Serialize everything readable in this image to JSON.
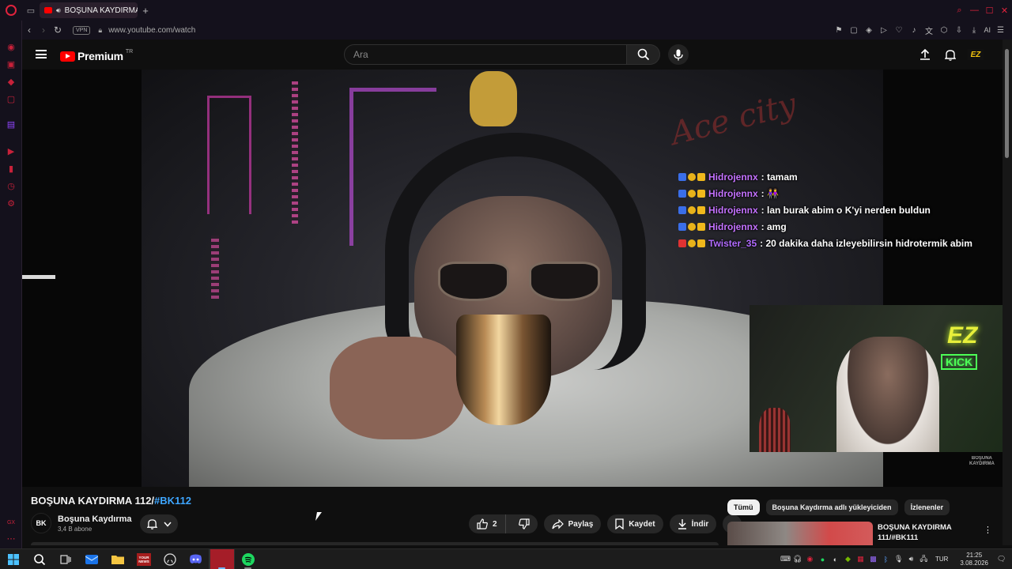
{
  "browser": {
    "tab_title": "BOŞUNA KAYDIRMA 112/",
    "new_tab_symbol": "+",
    "url": "www.youtube.com/watch",
    "vpn_label": "VPN",
    "ai_label": "AI",
    "accent_color": "#e0233d"
  },
  "youtube": {
    "logo_text": "Premium",
    "country_code": "TR",
    "search_placeholder": "Ara",
    "avatar_label": "EZ"
  },
  "video": {
    "chat": [
      {
        "user": "Hidrojennx",
        "message": ": tamam",
        "user_color": "#c472ff",
        "badge": "blue"
      },
      {
        "user": "Hidrojennx",
        "message": ": 👭",
        "user_color": "#c472ff",
        "badge": "blue"
      },
      {
        "user": "Hidrojennx",
        "message": ": lan burak abim o K'yi nerden buldun",
        "user_color": "#c472ff",
        "badge": "blue"
      },
      {
        "user": "Hidrojennx",
        "message": ": amg",
        "user_color": "#c472ff",
        "badge": "blue"
      },
      {
        "user": "Twister_35",
        "message": ": 20 dakika daha izleyebilirsin hidrotermik abim",
        "user_color": "#b26cff",
        "badge": "red"
      }
    ],
    "cam_sign_ez": "EZ",
    "cam_sign_kick": "KICK",
    "watermark_line1": "BOŞUNA",
    "watermark_line2": "KAYDIRMA"
  },
  "watch": {
    "title_main": "BOŞUNA KAYDIRMA 112/",
    "title_hashtag": "#BK112",
    "channel_avatar_text": "BK",
    "channel_name": "Boşuna Kaydırma",
    "subscribers": "3,4 B abone",
    "like_count": "2",
    "share_label": "Paylaş",
    "save_label": "Kaydet",
    "download_label": "İndir"
  },
  "related": {
    "chips": [
      "Tümü",
      "Boşuna Kaydırma adlı yükleyiciden",
      "İzlenenler"
    ],
    "first_video_title": "BOŞUNA KAYDIRMA 111/#BK111"
  },
  "taskbar": {
    "lang": "TUR",
    "time": "21:25",
    "date": "3.08.2026",
    "news_label": "YOUR NEWS"
  }
}
